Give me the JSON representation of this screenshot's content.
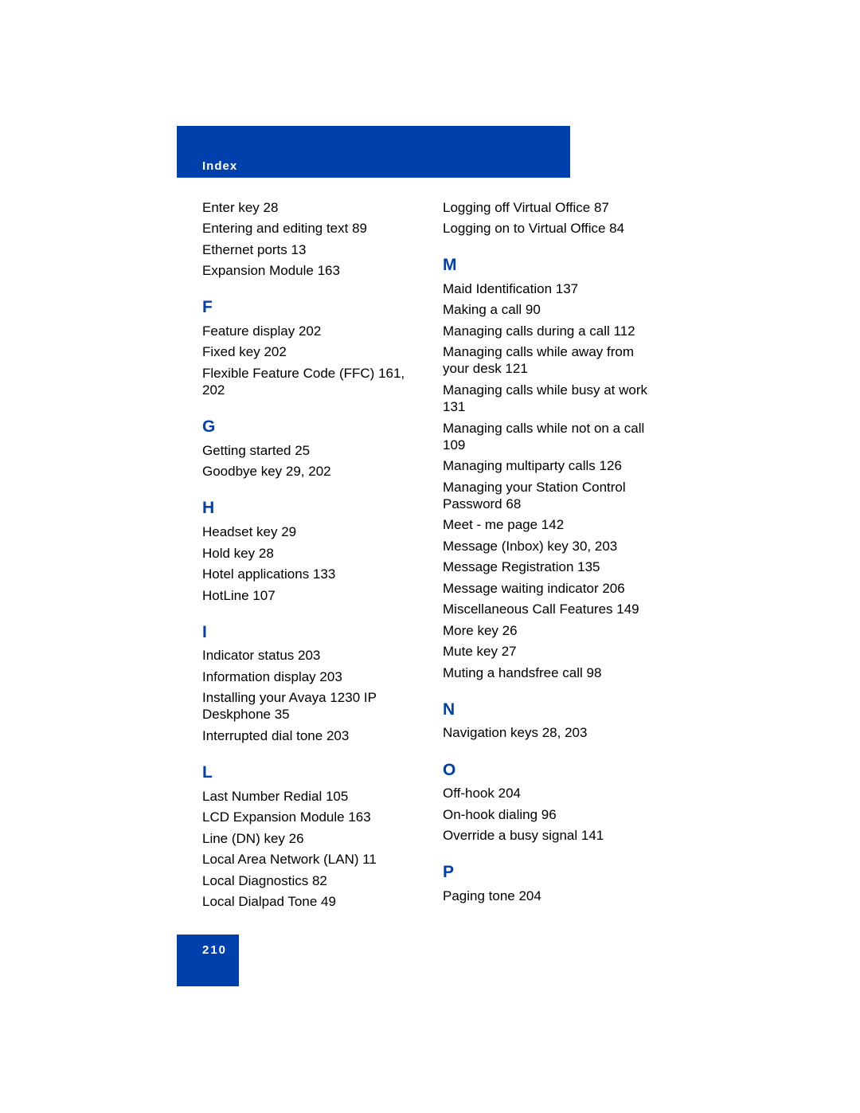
{
  "header": {
    "section_title": "Index",
    "band_color": "#0040ac"
  },
  "footer": {
    "page_number": "210"
  },
  "accent_color": "#0040ac",
  "left_column": {
    "continued_E": [
      "Enter key 28",
      "Entering and editing text 89",
      "Ethernet ports 13",
      "Expansion Module 163"
    ],
    "F": {
      "letter": "F",
      "entries": [
        "Feature display 202",
        "Fixed key 202",
        "Flexible Feature Code (FFC) 161,",
        "202"
      ]
    },
    "G": {
      "letter": "G",
      "entries": [
        "Getting started 25",
        "Goodbye key 29, 202"
      ]
    },
    "H": {
      "letter": "H",
      "entries": [
        "Headset key 29",
        "Hold key 28",
        "Hotel applications 133",
        "HotLine 107"
      ]
    },
    "I": {
      "letter": "I",
      "entries": [
        "Indicator status 203",
        "Information display 203",
        "Installing your Avaya 1230 IP",
        "Deskphone 35",
        "Interrupted dial tone 203"
      ]
    },
    "L": {
      "letter": "L",
      "entries": [
        "Last Number Redial 105",
        "LCD Expansion Module 163",
        "Line (DN) key 26",
        "Local Area Network (LAN) 11",
        "Local Diagnostics 82",
        "Local Dialpad Tone 49"
      ]
    }
  },
  "right_column": {
    "continued_L": [
      "Logging off Virtual Office 87",
      "Logging on to Virtual Office 84"
    ],
    "M": {
      "letter": "M",
      "entries": [
        "Maid Identification 137",
        "Making a call 90",
        "Managing calls during a call 112",
        "Managing calls while away from",
        "your desk 121",
        "Managing calls while busy at work",
        "131",
        "Managing calls while not on a call",
        "109",
        "Managing multiparty calls 126",
        "Managing your Station Control",
        "Password 68",
        "Meet - me page 142",
        "Message (Inbox) key 30, 203",
        "Message Registration 135",
        "Message waiting indicator 206",
        "Miscellaneous Call Features 149",
        "More key 26",
        "Mute key 27",
        "Muting a handsfree call 98"
      ]
    },
    "N": {
      "letter": "N",
      "entries": [
        "Navigation keys 28, 203"
      ]
    },
    "O": {
      "letter": "O",
      "entries": [
        "Off-hook 204",
        "On-hook dialing 96",
        "Override a busy signal 141"
      ]
    },
    "P": {
      "letter": "P",
      "entries": [
        "Paging tone 204"
      ]
    }
  }
}
